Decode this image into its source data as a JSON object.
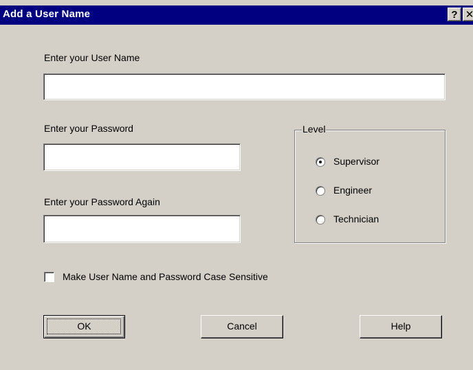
{
  "window": {
    "title": "Add a User Name",
    "help_btn": "?",
    "close_btn": "✕"
  },
  "user_name": {
    "label": "Enter your User Name",
    "value": ""
  },
  "password": {
    "label": "Enter your Password",
    "value": ""
  },
  "password_again": {
    "label": "Enter your Password Again",
    "value": ""
  },
  "level": {
    "legend": "Level",
    "options": [
      {
        "label": "Supervisor",
        "selected": true
      },
      {
        "label": "Engineer",
        "selected": false
      },
      {
        "label": "Technician",
        "selected": false
      }
    ]
  },
  "case_sensitive": {
    "label": "Make User Name and Password Case Sensitive",
    "checked": false
  },
  "buttons": {
    "ok": "OK",
    "cancel": "Cancel",
    "help": "Help"
  },
  "colors": {
    "titlebar": "#000080",
    "dialog_bg": "#d4d0c8"
  }
}
